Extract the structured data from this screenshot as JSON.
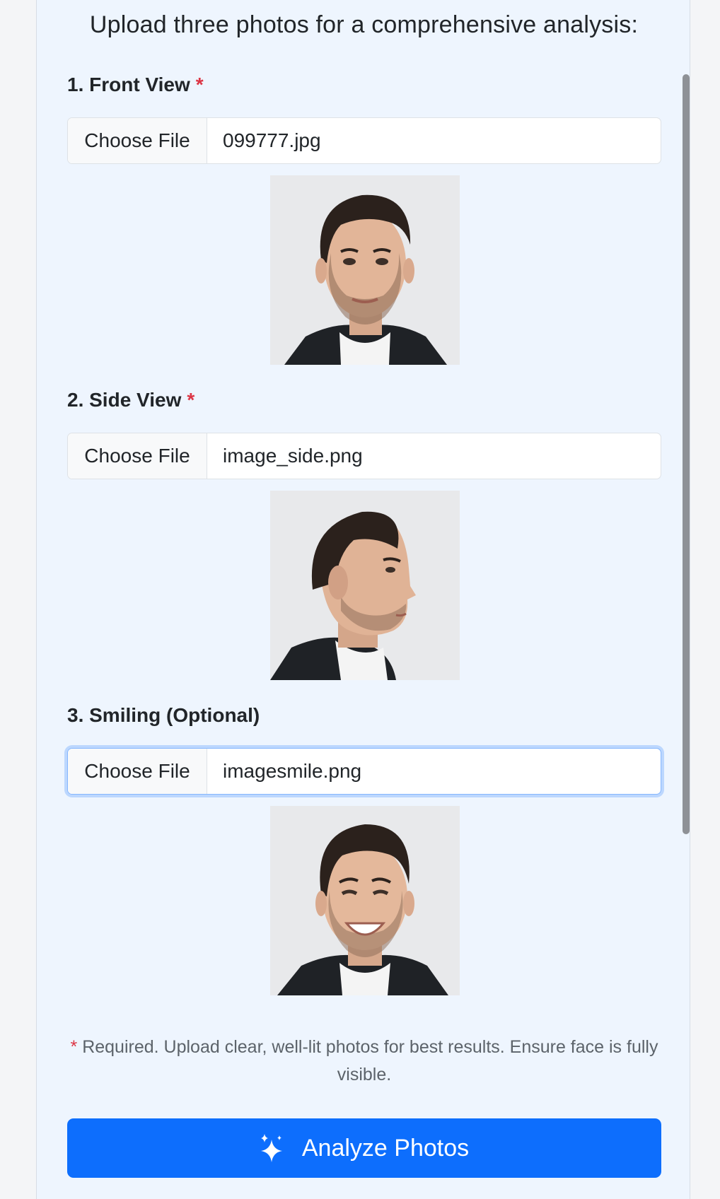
{
  "intro": "Upload three photos for a comprehensive analysis:",
  "required_marker": "*",
  "sections": [
    {
      "label": "1. Front View",
      "required": true,
      "button_label": "Choose File",
      "file_name": "099777.jpg",
      "preview": "front-view-photo"
    },
    {
      "label": "2. Side View",
      "required": true,
      "button_label": "Choose File",
      "file_name": "image_side.png",
      "preview": "side-view-photo"
    },
    {
      "label": "3. Smiling (Optional)",
      "required": false,
      "button_label": "Choose File",
      "file_name": "imagesmile.png",
      "preview": "smiling-photo",
      "focused": true
    }
  ],
  "note": {
    "marker": "*",
    "text": " Required. Upload clear, well-lit photos for best results. Ensure face is fully visible."
  },
  "analyze_button": {
    "label": "Analyze Photos",
    "icon": "sparkles-icon"
  },
  "colors": {
    "card_background": "#eef5fe",
    "primary": "#0d6efd",
    "required": "#dc3545",
    "focus_ring": "#86b7fe"
  }
}
